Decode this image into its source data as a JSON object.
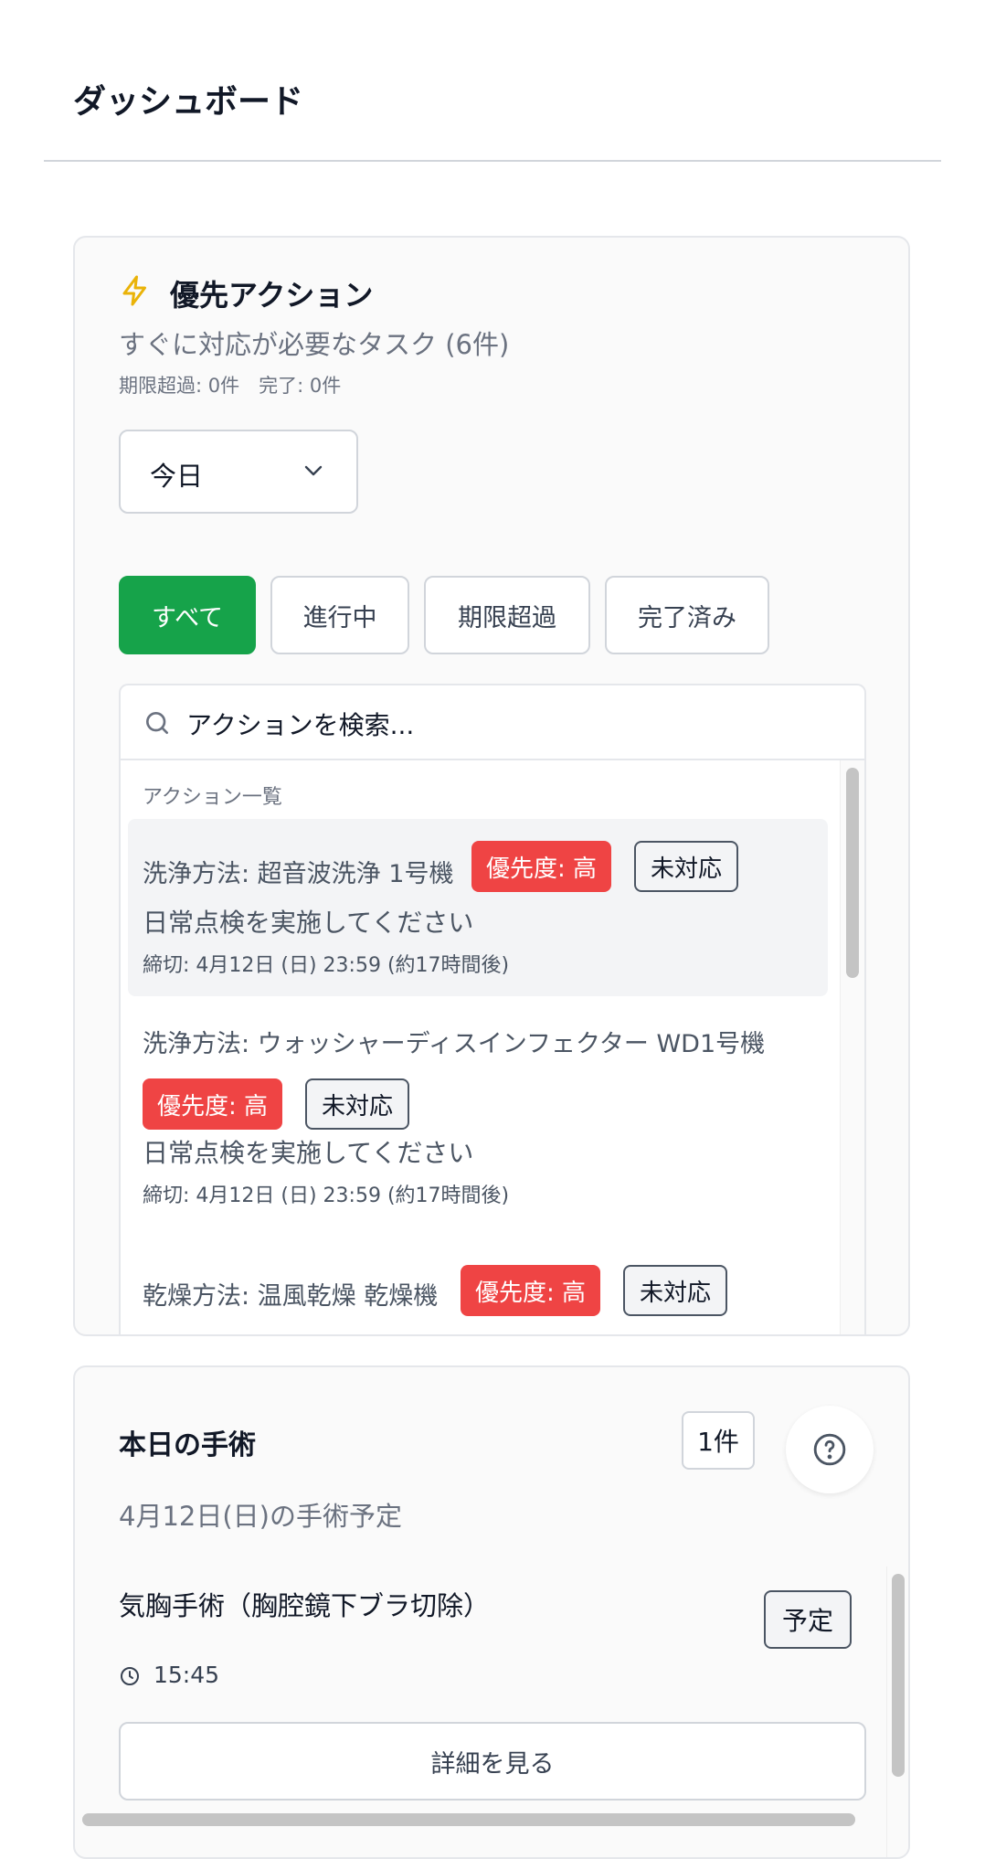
{
  "header": {
    "title": "ダッシュボード"
  },
  "actions": {
    "title": "優先アクション",
    "subtitle": "すぐに対応が必要なタスク (6件)",
    "stats": "期限超過: 0件　完了: 0件",
    "period_select": {
      "selected": "今日"
    },
    "filters": [
      {
        "label": "すべて",
        "active": true
      },
      {
        "label": "進行中",
        "active": false
      },
      {
        "label": "期限超過",
        "active": false
      },
      {
        "label": "完了済み",
        "active": false
      }
    ],
    "search": {
      "placeholder": "アクションを検索..."
    },
    "list_label": "アクション一覧",
    "items": [
      {
        "title": "洗浄方法: 超音波洗浄 1号機",
        "priority": "優先度: 高",
        "status": "未対応",
        "desc": "日常点検を実施してください",
        "due": "締切: 4月12日 (日) 23:59 (約17時間後)"
      },
      {
        "title": "洗浄方法: ウォッシャーディスインフェクター WD1号機",
        "priority": "優先度: 高",
        "status": "未対応",
        "desc": "日常点検を実施してください",
        "due": "締切: 4月12日 (日) 23:59 (約17時間後)"
      },
      {
        "title": "乾燥方法: 温風乾燥 乾燥機",
        "priority": "優先度: 高",
        "status": "未対応"
      }
    ],
    "colors": {
      "accent": "#16a34a",
      "priority_high": "#ef4444",
      "icon": "#eab308"
    }
  },
  "surgery": {
    "title": "本日の手術",
    "count": "1件",
    "subtitle": "4月12日(日)の手術予定",
    "item": {
      "name": "気胸手術（胸腔鏡下ブラ切除）",
      "status": "予定",
      "time": "15:45"
    },
    "detail_button": "詳細を見る"
  }
}
